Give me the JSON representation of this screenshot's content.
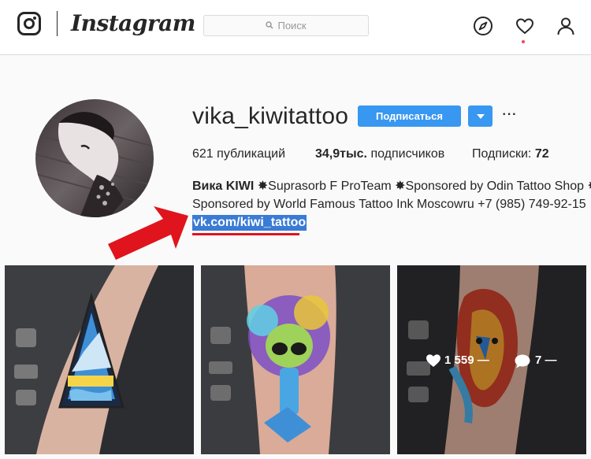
{
  "header": {
    "wordmark": "Instagram",
    "search_placeholder": "Поиск",
    "icons": [
      "instagram-glyph-icon",
      "compass-icon",
      "heart-icon",
      "user-icon",
      "search-icon"
    ]
  },
  "profile": {
    "username": "vika_kiwitattoo",
    "follow_label": "Подписаться",
    "more_label": "···",
    "stats": [
      {
        "value": "621",
        "label": "публикаций"
      },
      {
        "value": "34,9тыс.",
        "label": "подписчиков"
      },
      {
        "label": "Подписки:",
        "value": "72"
      }
    ],
    "bio": {
      "name": "Вика KIWI",
      "line1_rest": "✸Suprasorb F ProTeam ✸Sponsored by Odin Tattoo Shop ✸",
      "line2": "Sponsored by World Famous Tattoo Ink Moscowru +7 (985) 749-92-15",
      "link": "vk.com/kiwi_tattoo"
    }
  },
  "posts": [
    {
      "alt": "triangle mountain tattoo on forearm"
    },
    {
      "alt": "alien watercolor tattoo on forearm"
    },
    {
      "alt": "lion watercolor tattoo on forearm",
      "likes": "1 559 —",
      "comments": "7 —"
    }
  ],
  "colors": {
    "accent": "#3897f0",
    "link_highlight": "#3a7bd5",
    "annotation_red": "#e0141c",
    "notification": "#ed4956"
  }
}
